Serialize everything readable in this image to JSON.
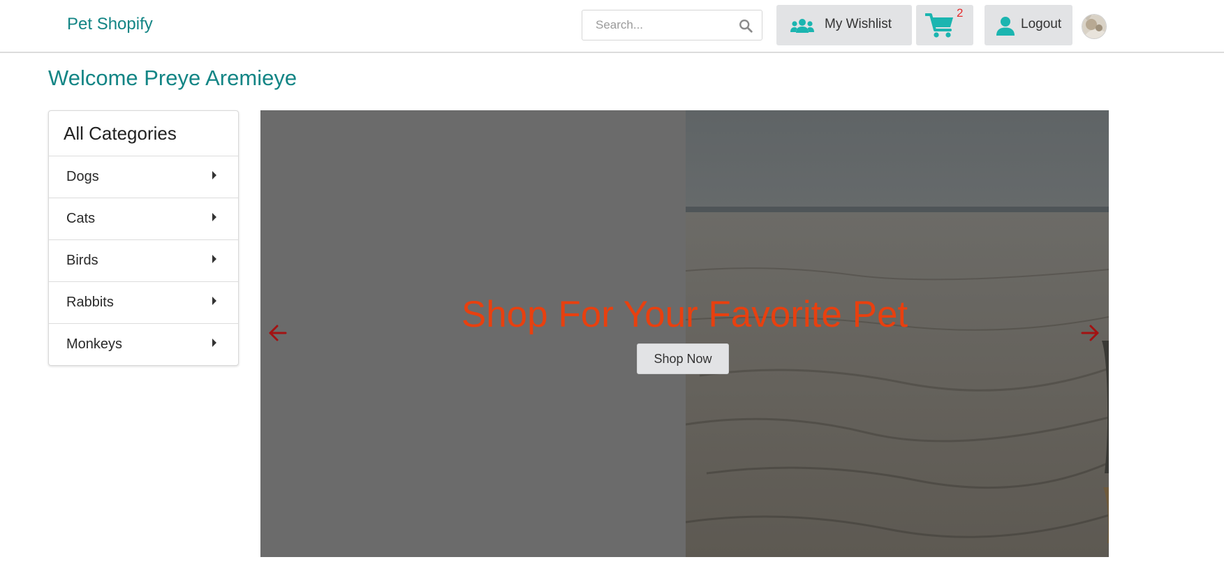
{
  "header": {
    "brand": "Pet Shopify",
    "search": {
      "placeholder": "Search...",
      "value": ""
    },
    "wishlist_label": "My Wishlist",
    "cart_count": "2",
    "logout_label": "Logout",
    "icons": {
      "search": "search-icon",
      "wishlist": "users-icon",
      "cart": "cart-icon",
      "logout": "user-icon"
    }
  },
  "welcome": "Welcome Preye Aremieye",
  "sidebar": {
    "heading": "All Categories",
    "items": [
      {
        "label": "Dogs"
      },
      {
        "label": "Cats"
      },
      {
        "label": "Birds"
      },
      {
        "label": "Rabbits"
      },
      {
        "label": "Monkeys"
      }
    ]
  },
  "hero": {
    "title": "Shop For Your Favorite Pet",
    "button_label": "Shop Now",
    "icons": {
      "prev": "arrow-left-icon",
      "next": "arrow-right-icon"
    }
  },
  "colors": {
    "brand_teal": "#138585",
    "icon_teal": "#1bb5b0",
    "hero_title": "#e8400f",
    "badge_red": "#e52b2b",
    "arrow_red": "#a31212",
    "button_grey": "#e2e3e5"
  }
}
